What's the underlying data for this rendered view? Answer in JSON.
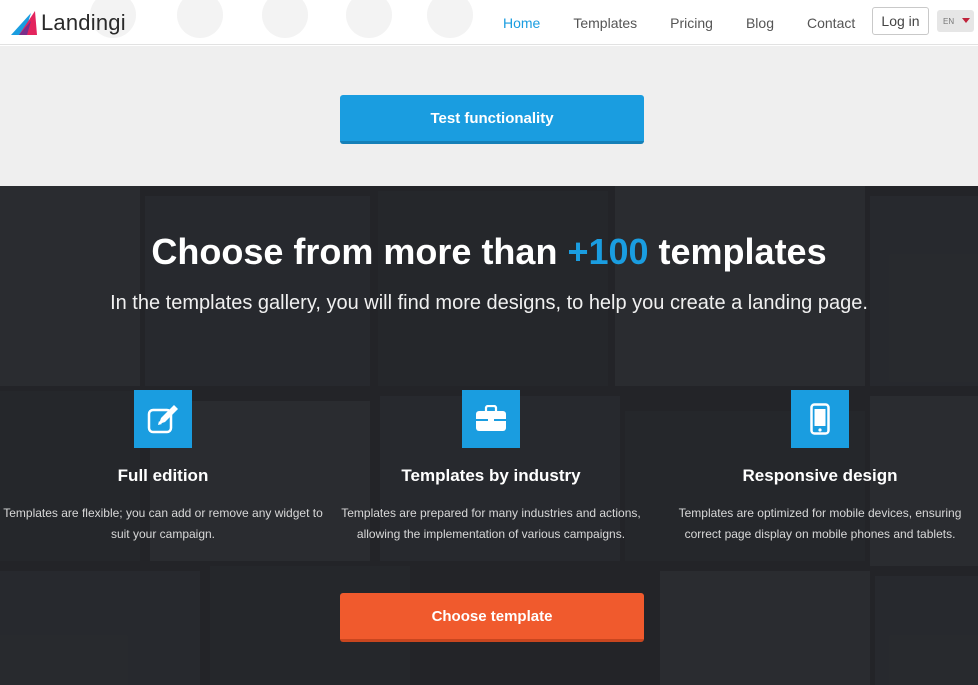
{
  "header": {
    "logo_text": "Landingi",
    "nav": [
      {
        "label": "Home",
        "active": true
      },
      {
        "label": "Templates",
        "active": false
      },
      {
        "label": "Pricing",
        "active": false
      },
      {
        "label": "Blog",
        "active": false
      },
      {
        "label": "Contact",
        "active": false
      }
    ],
    "login_label": "Log in",
    "language": "EN"
  },
  "test_section": {
    "button_label": "Test functionality"
  },
  "templates_section": {
    "headline_pre": "Choose from more than ",
    "headline_accent": "+100",
    "headline_post": " templates",
    "subheadline": "In the templates gallery, you will find more designs, to help you create a landing page.",
    "features": [
      {
        "icon": "edit-icon",
        "title": "Full edition",
        "description": "Templates are flexible; you can add or remove any widget to suit your campaign."
      },
      {
        "icon": "briefcase-icon",
        "title": "Templates by industry",
        "description": "Templates are prepared for many industries and actions, allowing the implementation of various campaigns."
      },
      {
        "icon": "mobile-phone-icon",
        "title": "Responsive design",
        "description": "Templates are optimized for mobile devices, ensuring correct page display on mobile phones and tablets."
      }
    ],
    "cta_label": "Choose template"
  },
  "colors": {
    "accent_blue": "#1a9de0",
    "cta_orange": "#f05a2d",
    "dark_bg": "#2a2c30",
    "grey_band": "#efefef"
  }
}
